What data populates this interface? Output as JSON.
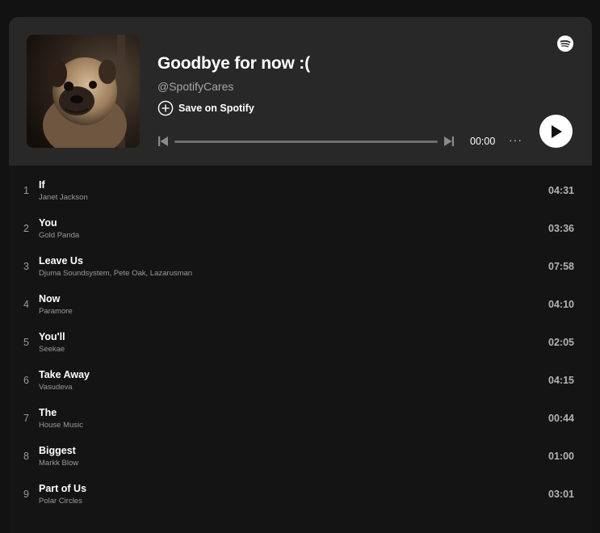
{
  "playlist": {
    "title": "Goodbye for now :(",
    "owner": "@SpotifyCares",
    "save_label": "Save on Spotify"
  },
  "player": {
    "time": "00:00",
    "progress": 0,
    "more_label": "···"
  },
  "icons": {
    "logo": "spotify-logo-icon",
    "save": "plus-circle-icon",
    "prev": "skip-previous-icon",
    "next": "skip-next-icon",
    "play": "play-icon"
  },
  "colors": {
    "background": "#121212",
    "header": "#282828",
    "text": "#ffffff",
    "muted": "#a7a7a7"
  },
  "tracks": [
    {
      "num": "1",
      "name": "If",
      "artist": "Janet Jackson",
      "duration": "04:31"
    },
    {
      "num": "2",
      "name": "You",
      "artist": "Gold Panda",
      "duration": "03:36"
    },
    {
      "num": "3",
      "name": "Leave Us",
      "artist": "Djuma Soundsystem, Pete Oak, Lazarusman",
      "duration": "07:58"
    },
    {
      "num": "4",
      "name": "Now",
      "artist": "Paramore",
      "duration": "04:10"
    },
    {
      "num": "5",
      "name": "You'll",
      "artist": "Seekae",
      "duration": "02:05"
    },
    {
      "num": "6",
      "name": "Take Away",
      "artist": "Vasudeva",
      "duration": "04:15"
    },
    {
      "num": "7",
      "name": "The",
      "artist": "House Music",
      "duration": "00:44"
    },
    {
      "num": "8",
      "name": "Biggest",
      "artist": "Markk Blow",
      "duration": "01:00"
    },
    {
      "num": "9",
      "name": "Part of Us",
      "artist": "Polar Circles",
      "duration": "03:01"
    }
  ]
}
